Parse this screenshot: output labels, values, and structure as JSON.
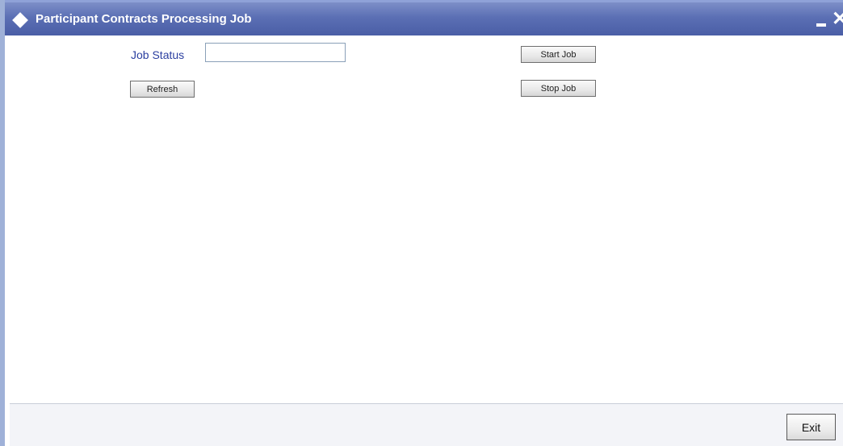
{
  "window": {
    "title": "Participant Contracts Processing Job",
    "icons": {
      "title": "diamond-icon",
      "minimize": "minimize-icon",
      "close": "close-icon"
    },
    "close_glyph": "✕"
  },
  "form": {
    "job_status_label": "Job Status",
    "job_status_value": "",
    "job_status_placeholder": ""
  },
  "buttons": {
    "refresh": "Refresh",
    "start_job": "Start Job",
    "stop_job": "Stop Job",
    "exit": "Exit"
  },
  "colors": {
    "titlebar": "#4a5ea6",
    "label_text": "#2b3fa0",
    "footer": "#f3f4f8"
  }
}
